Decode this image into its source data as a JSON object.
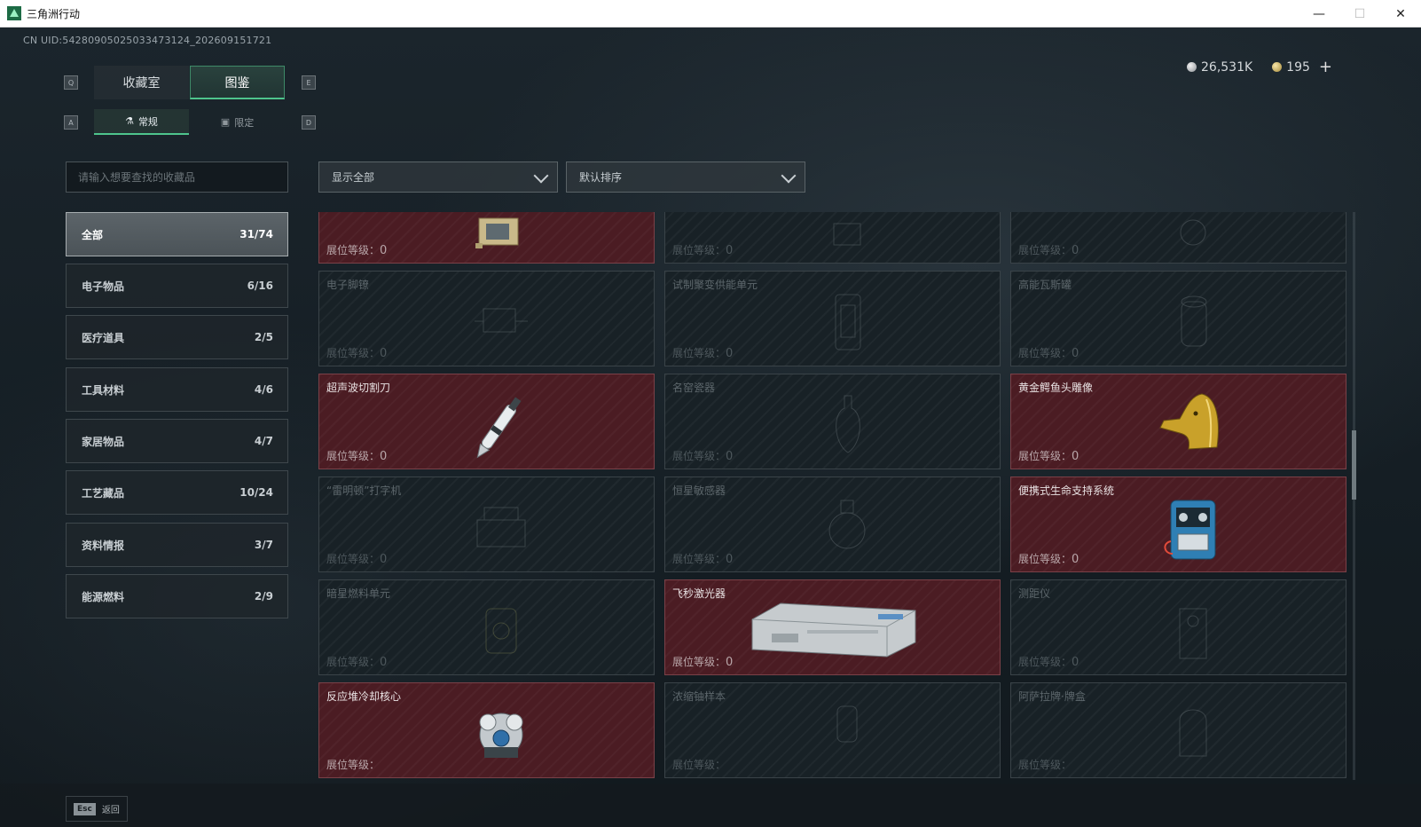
{
  "window": {
    "title": "三角洲行动",
    "minimize": "—",
    "maximize": "☐",
    "close": "✕"
  },
  "uid": "CN UID:542809050250334731​24_202609151721",
  "currency": {
    "silver": "26,531K",
    "gold": "195",
    "plus": "+"
  },
  "main_tabs": {
    "key_left": "Q",
    "key_right": "E",
    "tabs": [
      {
        "label": "收藏室"
      },
      {
        "label": "图鉴"
      }
    ]
  },
  "sub_tabs": {
    "key_left": "A",
    "key_right": "D",
    "tabs": [
      {
        "label": "常规"
      },
      {
        "label": "限定"
      }
    ]
  },
  "search": {
    "placeholder": "请输入想要查找的收藏品"
  },
  "filters": {
    "show": "显示全部",
    "sort": "默认排序"
  },
  "categories": [
    {
      "label": "全部",
      "count": "31/74"
    },
    {
      "label": "电子物品",
      "count": "6/16"
    },
    {
      "label": "医疗道具",
      "count": "2/5"
    },
    {
      "label": "工具材料",
      "count": "4/6"
    },
    {
      "label": "家居物品",
      "count": "4/7"
    },
    {
      "label": "工艺藏品",
      "count": "10/24"
    },
    {
      "label": "资料情报",
      "count": "3/7"
    },
    {
      "label": "能源燃料",
      "count": "2/9"
    }
  ],
  "level_label": "展位等级：",
  "items": [
    {
      "name": "",
      "level": "0",
      "owned": true,
      "icon": "device-icon"
    },
    {
      "name": "",
      "level": "0",
      "owned": false,
      "icon": "device-icon"
    },
    {
      "name": "",
      "level": "0",
      "owned": false,
      "icon": "device-icon"
    },
    {
      "name": "电子脚镣",
      "level": "0",
      "owned": false,
      "icon": "ankle-monitor-icon"
    },
    {
      "name": "试制聚变供能单元",
      "level": "0",
      "owned": false,
      "icon": "fusion-unit-icon"
    },
    {
      "name": "高能瓦斯罐",
      "level": "0",
      "owned": false,
      "icon": "gas-canister-icon"
    },
    {
      "name": "超声波切割刀",
      "level": "0",
      "owned": true,
      "icon": "ultrasonic-cutter-icon"
    },
    {
      "name": "名窑瓷器",
      "level": "0",
      "owned": false,
      "icon": "porcelain-vase-icon"
    },
    {
      "name": "黄金鳄鱼头雕像",
      "level": "0",
      "owned": true,
      "icon": "golden-crocodile-icon"
    },
    {
      "name": "“雷明顿”打字机",
      "level": "0",
      "owned": false,
      "icon": "typewriter-icon"
    },
    {
      "name": "恒星敏感器",
      "level": "0",
      "owned": false,
      "icon": "star-sensor-icon"
    },
    {
      "name": "便携式生命支持系统",
      "level": "0",
      "owned": true,
      "icon": "life-support-icon"
    },
    {
      "name": "暗星燃料单元",
      "level": "0",
      "owned": false,
      "icon": "fuel-unit-icon"
    },
    {
      "name": "飞秒激光器",
      "level": "0",
      "owned": true,
      "icon": "femtosecond-laser-icon"
    },
    {
      "name": "测距仪",
      "level": "0",
      "owned": false,
      "icon": "rangefinder-icon"
    },
    {
      "name": "反应堆冷却核心",
      "level": "",
      "owned": true,
      "icon": "reactor-core-icon"
    },
    {
      "name": "浓缩铀样本",
      "level": "",
      "owned": false,
      "icon": "uranium-sample-icon"
    },
    {
      "name": "阿萨拉牌·牌盒",
      "level": "",
      "owned": false,
      "icon": "card-box-icon"
    }
  ],
  "footer": {
    "key": "Esc",
    "label": "返回"
  },
  "colors": {
    "accent": "#4ec48c",
    "owned_card": "#4b1c23",
    "unowned_card": "#182126"
  }
}
